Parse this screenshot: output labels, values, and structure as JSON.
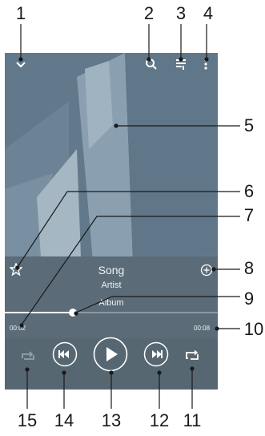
{
  "callouts": [
    "1",
    "2",
    "3",
    "4",
    "5",
    "6",
    "7",
    "8",
    "9",
    "10",
    "11",
    "12",
    "13",
    "14",
    "15"
  ],
  "player": {
    "song": "Song",
    "artist": "Artist",
    "album": "Album",
    "elapsed": "00:02",
    "duration": "00:08",
    "progress_fraction": 0.32
  },
  "icons": {
    "collapse": "chevron-down-icon",
    "search": "search-icon",
    "queue": "queue-icon",
    "menu": "more-vertical-icon",
    "favorite": "star-icon",
    "add": "add-circle-icon",
    "shuffle": "shuffle-icon",
    "previous": "previous-icon",
    "play": "play-icon",
    "next": "next-icon",
    "repeat": "repeat-icon"
  },
  "colors": {
    "art_bg": "#5d7586",
    "controls_bg": "#5b6c78",
    "accent_white": "#ffffff"
  }
}
